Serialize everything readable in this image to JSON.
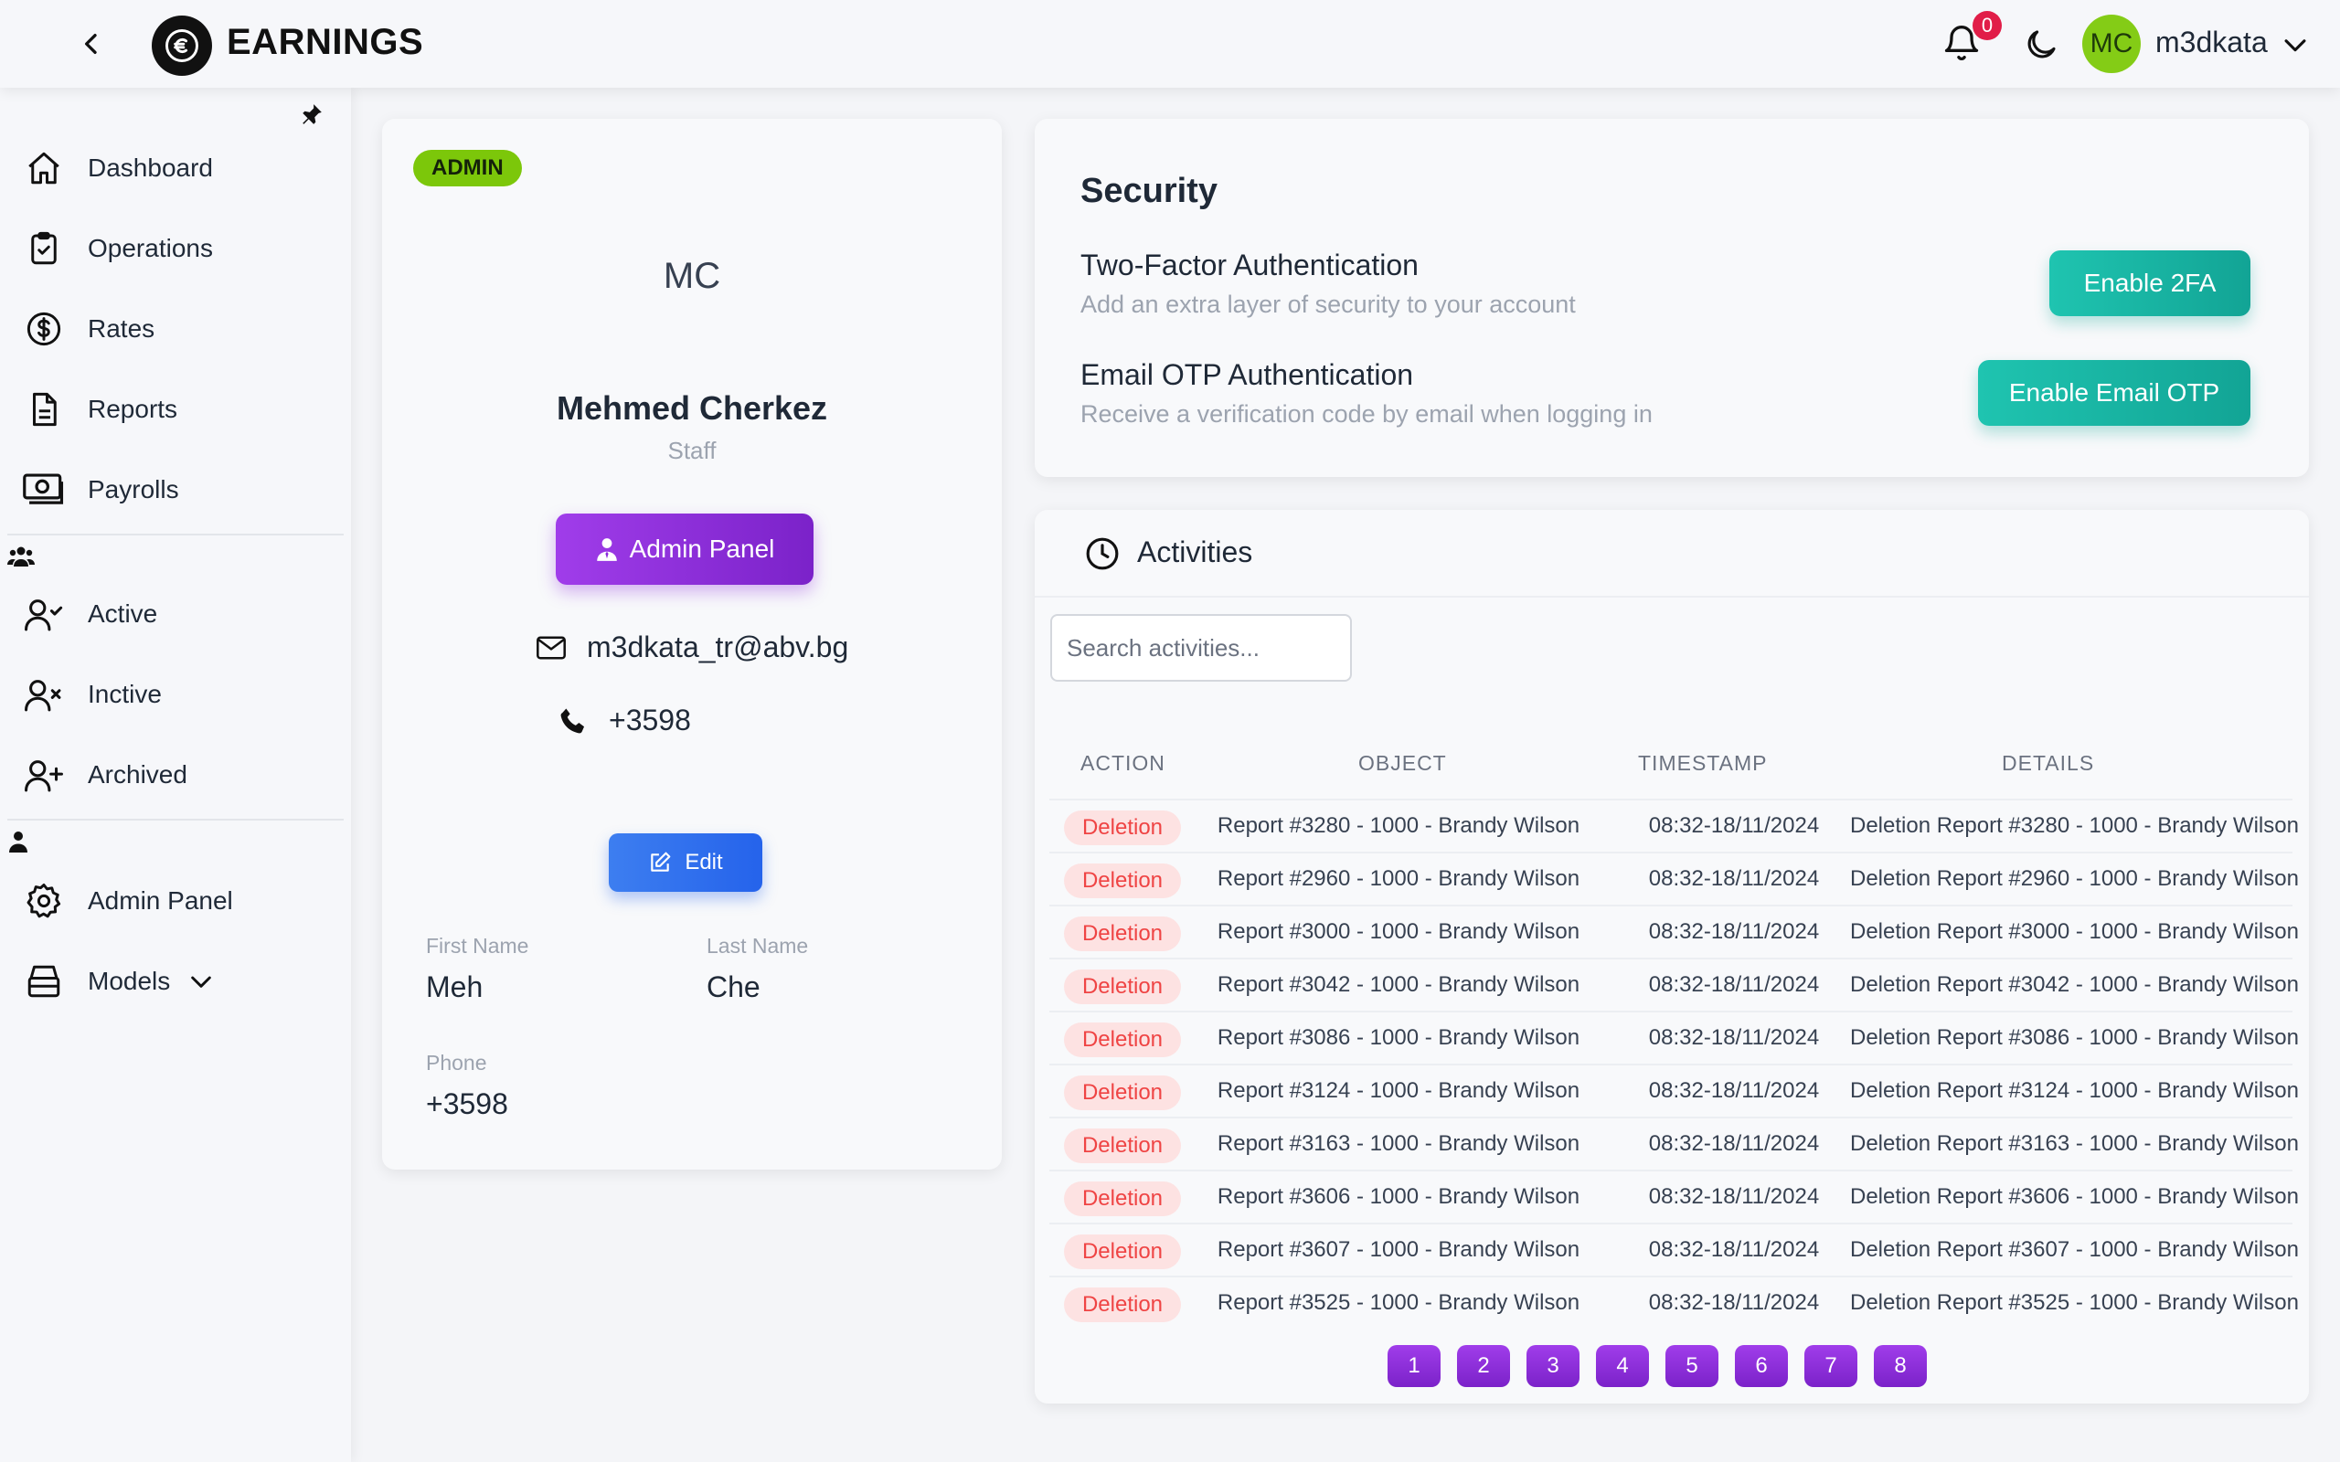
{
  "app": {
    "title": "EARNINGS"
  },
  "topbar": {
    "notification_count": "0",
    "avatar_initials": "MC",
    "username": "m3dkata"
  },
  "sidebar": {
    "items": [
      {
        "label": "Dashboard",
        "icon": "home-icon"
      },
      {
        "label": "Operations",
        "icon": "clipboard-check-icon"
      },
      {
        "label": "Rates",
        "icon": "dollar-circle-icon"
      },
      {
        "label": "Reports",
        "icon": "document-icon"
      },
      {
        "label": "Payrolls",
        "icon": "cash-icon"
      }
    ],
    "users_group": [
      {
        "label": "Active",
        "icon": "user-check-icon"
      },
      {
        "label": "Inctive",
        "icon": "user-x-icon"
      },
      {
        "label": "Archived",
        "icon": "user-plus-icon"
      }
    ],
    "admin_group": [
      {
        "label": "Admin Panel",
        "icon": "gear-icon"
      },
      {
        "label": "Models",
        "icon": "database-icon"
      }
    ]
  },
  "profile": {
    "badge": "ADMIN",
    "initials": "MC",
    "name": "Mehmed Cherkez",
    "role": "Staff",
    "admin_button": "Admin Panel",
    "email": "m3dkata_tr@abv.bg",
    "phone": "+3598",
    "edit_button": "Edit",
    "first_name_label": "First Name",
    "first_name": "Meh",
    "last_name_label": "Last Name",
    "last_name": "Che",
    "phone_label": "Phone",
    "phone_value": "+3598"
  },
  "security": {
    "title": "Security",
    "twofa_title": "Two-Factor Authentication",
    "twofa_sub": "Add an extra layer of security to your account",
    "twofa_button": "Enable 2FA",
    "otp_title": "Email OTP Authentication",
    "otp_sub": "Receive a verification code by email when logging in",
    "otp_button": "Enable Email OTP"
  },
  "activities": {
    "title": "Activities",
    "search_placeholder": "Search activities...",
    "columns": [
      "ACTION",
      "OBJECT",
      "TIMESTAMP",
      "DETAILS"
    ],
    "rows": [
      {
        "action": "Deletion",
        "object": "Report #3280 - 1000 - Brandy Wilson",
        "timestamp": "08:32-18/11/2024",
        "details": "Deletion Report #3280 - 1000 - Brandy Wilson"
      },
      {
        "action": "Deletion",
        "object": "Report #2960 - 1000 - Brandy Wilson",
        "timestamp": "08:32-18/11/2024",
        "details": "Deletion Report #2960 - 1000 - Brandy Wilson"
      },
      {
        "action": "Deletion",
        "object": "Report #3000 - 1000 - Brandy Wilson",
        "timestamp": "08:32-18/11/2024",
        "details": "Deletion Report #3000 - 1000 - Brandy Wilson"
      },
      {
        "action": "Deletion",
        "object": "Report #3042 - 1000 - Brandy Wilson",
        "timestamp": "08:32-18/11/2024",
        "details": "Deletion Report #3042 - 1000 - Brandy Wilson"
      },
      {
        "action": "Deletion",
        "object": "Report #3086 - 1000 - Brandy Wilson",
        "timestamp": "08:32-18/11/2024",
        "details": "Deletion Report #3086 - 1000 - Brandy Wilson"
      },
      {
        "action": "Deletion",
        "object": "Report #3124 - 1000 - Brandy Wilson",
        "timestamp": "08:32-18/11/2024",
        "details": "Deletion Report #3124 - 1000 - Brandy Wilson"
      },
      {
        "action": "Deletion",
        "object": "Report #3163 - 1000 - Brandy Wilson",
        "timestamp": "08:32-18/11/2024",
        "details": "Deletion Report #3163 - 1000 - Brandy Wilson"
      },
      {
        "action": "Deletion",
        "object": "Report #3606 - 1000 - Brandy Wilson",
        "timestamp": "08:32-18/11/2024",
        "details": "Deletion Report #3606 - 1000 - Brandy Wilson"
      },
      {
        "action": "Deletion",
        "object": "Report #3607 - 1000 - Brandy Wilson",
        "timestamp": "08:32-18/11/2024",
        "details": "Deletion Report #3607 - 1000 - Brandy Wilson"
      },
      {
        "action": "Deletion",
        "object": "Report #3525 - 1000 - Brandy Wilson",
        "timestamp": "08:32-18/11/2024",
        "details": "Deletion Report #3525 - 1000 - Brandy Wilson"
      }
    ],
    "pages": [
      "1",
      "2",
      "3",
      "4",
      "5",
      "6",
      "7",
      "8"
    ]
  },
  "colors": {
    "accent_purple": "#8b2cdc",
    "teal": "#14b8a6",
    "admin_green": "#7cc70a",
    "blue": "#2563eb",
    "danger": "#ef4444"
  }
}
